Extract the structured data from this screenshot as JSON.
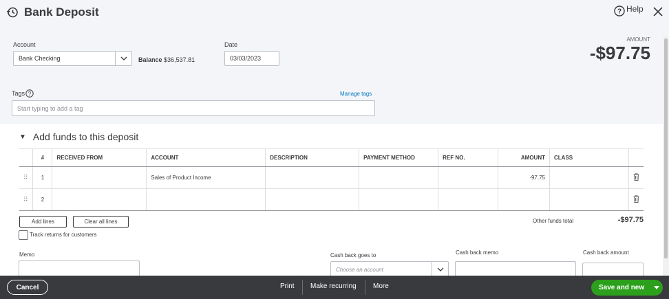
{
  "header": {
    "title": "Bank Deposit",
    "help_label": "Help",
    "account_label": "Account",
    "account_value": "Bank Checking",
    "balance_label": "Balance",
    "balance_value": "$36,537.81",
    "date_label": "Date",
    "date_value": "03/03/2023",
    "amount_label": "AMOUNT",
    "amount_value": "-$97.75",
    "tags_label": "Tags",
    "manage_tags": "Manage tags",
    "tags_placeholder": "Start typing to add a tag"
  },
  "section": {
    "title": "Add funds to this deposit",
    "columns": [
      "#",
      "RECEIVED FROM",
      "ACCOUNT",
      "DESCRIPTION",
      "PAYMENT METHOD",
      "REF NO.",
      "AMOUNT",
      "CLASS"
    ],
    "rows": [
      {
        "num": "1",
        "received_from": "",
        "account": "Sales of Product Income",
        "description": "",
        "payment_method": "",
        "ref_no": "",
        "amount": "-97.75",
        "class": ""
      },
      {
        "num": "2",
        "received_from": "",
        "account": "",
        "description": "",
        "payment_method": "",
        "ref_no": "",
        "amount": "",
        "class": ""
      }
    ],
    "add_lines": "Add lines",
    "clear_all_lines": "Clear all lines",
    "other_funds_label": "Other funds total",
    "other_funds_value": "-$97.75",
    "track_returns": "Track returns for customers"
  },
  "bottom": {
    "memo_label": "Memo",
    "cash_back_goes_to_label": "Cash back goes to",
    "cash_back_goes_to_placeholder": "Choose an account",
    "cash_back_memo_label": "Cash back memo",
    "cash_back_amount_label": "Cash back amount"
  },
  "footer": {
    "cancel": "Cancel",
    "print": "Print",
    "make_recurring": "Make recurring",
    "more": "More",
    "save_and_new": "Save and new"
  },
  "colors": {
    "header_bg": "#f4f5f8",
    "footer_bg": "#393a3d",
    "save_green": "#2ca01c",
    "link_blue": "#0077c5"
  }
}
